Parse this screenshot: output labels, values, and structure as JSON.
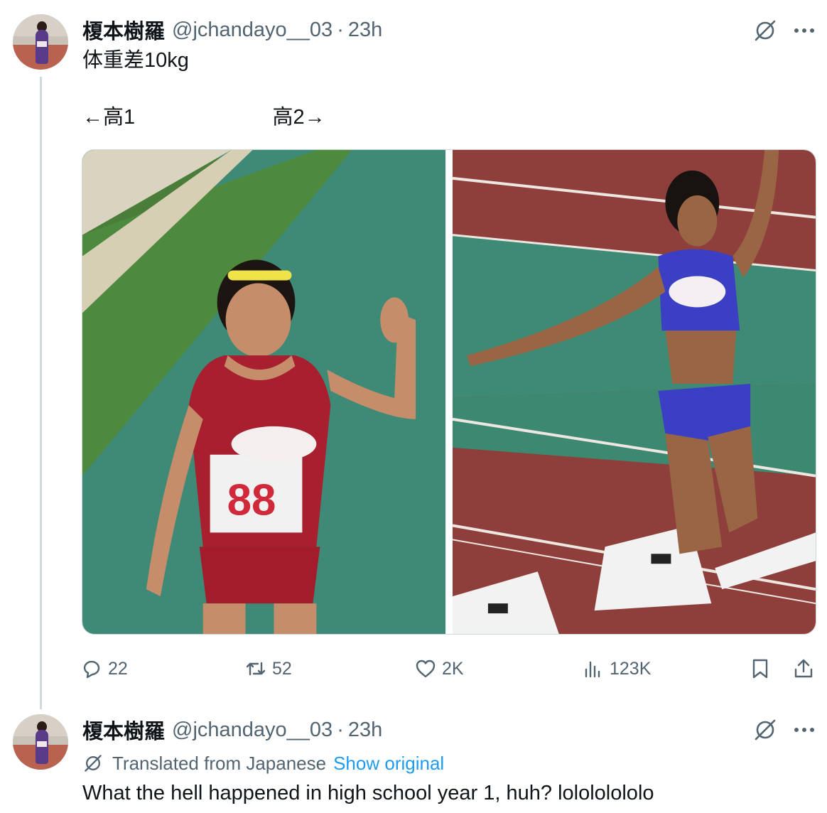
{
  "tweets": [
    {
      "author_name": "榎本樹羅",
      "handle": "@jchandayo__03",
      "separator": "·",
      "time": "23h",
      "lines": [
        "体重差10kg",
        "",
        "←高1                        高2→"
      ],
      "media": [
        {
          "label": "88"
        },
        {
          "label": ""
        }
      ],
      "stats": {
        "replies": "22",
        "reposts": "52",
        "likes": "2K",
        "views": "123K"
      }
    },
    {
      "author_name": "榎本樹羅",
      "handle": "@jchandayo__03",
      "separator": "·",
      "time": "23h",
      "translated_label": "Translated from Japanese",
      "show_original": "Show original",
      "text": "What the hell happened in high school year 1, huh? lolololololo"
    }
  ],
  "icons": {
    "grok": "grok-slash-icon",
    "more": "more-dots-icon",
    "reply": "reply-bubble-icon",
    "repost": "repost-arrows-icon",
    "like": "heart-icon",
    "views": "bar-chart-icon",
    "bookmark": "bookmark-icon",
    "share": "share-upload-icon",
    "translate": "translate-globe-icon"
  },
  "colors": {
    "text": "#0f1419",
    "secondary": "#536471",
    "link": "#1d9bf0",
    "border": "#cfd9de"
  }
}
